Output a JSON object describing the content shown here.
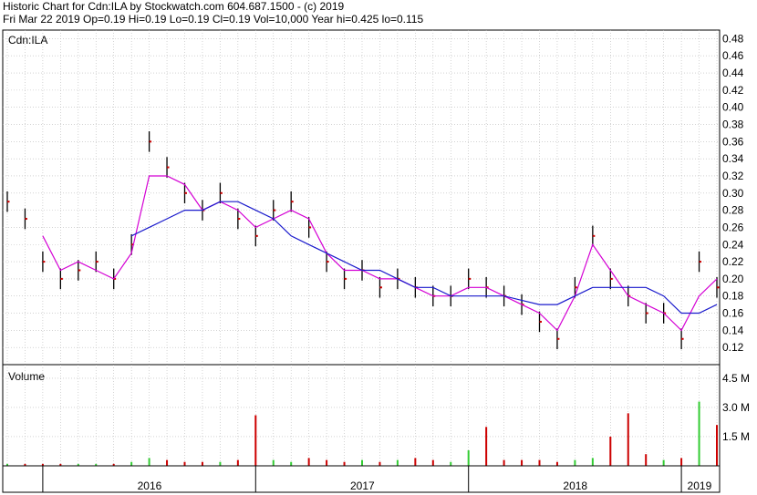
{
  "header": {
    "title": "Historic Chart for Cdn:ILA by Stockwatch.com 604.687.1500 - (c) 2019",
    "summary": "Fri Mar 22 2019  Op=0.19  Hi=0.19  Lo=0.19  Cl=0.19  Vol=10,000  Year hi=0.425  lo=0.115"
  },
  "colors": {
    "price": "#000000",
    "up_close_mark": "#cc0000",
    "ma_short": "#d400d4",
    "ma_long": "#1a1acc",
    "volume_up": "#33cc33",
    "volume_down": "#cc0000",
    "grid": "#b8b8b8",
    "frame": "#000000"
  },
  "chart_data": [
    {
      "type": "line",
      "panel": "price",
      "symbol_label": "Cdn:ILA",
      "grid": true,
      "ylim": [
        0.1,
        0.49
      ],
      "y_ticks": [
        "0.48",
        "0.46",
        "0.44",
        "0.42",
        "0.40",
        "0.38",
        "0.36",
        "0.34",
        "0.32",
        "0.30",
        "0.28",
        "0.26",
        "0.24",
        "0.22",
        "0.20",
        "0.18",
        "0.16",
        "0.14",
        "0.12"
      ],
      "x_labels": [
        "2016",
        "2017",
        "2018",
        "2019"
      ],
      "x_points": [
        "2015-11",
        "2015-12",
        "2016-01",
        "2016-02",
        "2016-03",
        "2016-04",
        "2016-05",
        "2016-06",
        "2016-07",
        "2016-08",
        "2016-09",
        "2016-10",
        "2016-11",
        "2016-12",
        "2017-01",
        "2017-02",
        "2017-03",
        "2017-04",
        "2017-05",
        "2017-06",
        "2017-07",
        "2017-08",
        "2017-09",
        "2017-10",
        "2017-11",
        "2017-12",
        "2018-01",
        "2018-02",
        "2018-03",
        "2018-04",
        "2018-05",
        "2018-06",
        "2018-07",
        "2018-08",
        "2018-09",
        "2018-10",
        "2018-11",
        "2018-12",
        "2019-01",
        "2019-02",
        "2019-03"
      ],
      "series": [
        {
          "values": [
            0.29,
            0.27,
            0.22,
            0.2,
            0.21,
            0.22,
            0.2,
            0.24,
            0.36,
            0.33,
            0.3,
            0.28,
            0.3,
            0.27,
            0.25,
            0.28,
            0.29,
            0.26,
            0.22,
            0.2,
            0.21,
            0.19,
            0.2,
            0.19,
            0.18,
            0.18,
            0.2,
            0.19,
            0.18,
            0.17,
            0.15,
            0.13,
            0.19,
            0.25,
            0.2,
            0.18,
            0.16,
            0.16,
            0.13,
            0.22,
            0.19
          ]
        },
        {
          "values": [
            null,
            null,
            0.25,
            0.21,
            0.22,
            0.21,
            0.2,
            0.23,
            0.32,
            0.32,
            0.31,
            0.28,
            0.29,
            0.28,
            0.26,
            0.27,
            0.28,
            0.27,
            0.23,
            0.21,
            0.21,
            0.2,
            0.2,
            0.19,
            0.18,
            0.18,
            0.19,
            0.19,
            0.18,
            0.17,
            0.16,
            0.14,
            0.18,
            0.24,
            0.21,
            0.18,
            0.17,
            0.16,
            0.14,
            0.18,
            0.2
          ]
        },
        {
          "values": [
            null,
            null,
            null,
            null,
            null,
            null,
            null,
            0.25,
            0.26,
            0.27,
            0.28,
            0.28,
            0.29,
            0.29,
            0.28,
            0.27,
            0.25,
            0.24,
            0.23,
            0.22,
            0.21,
            0.21,
            0.2,
            0.19,
            0.19,
            0.18,
            0.18,
            0.18,
            0.18,
            0.175,
            0.17,
            0.17,
            0.18,
            0.19,
            0.19,
            0.19,
            0.19,
            0.18,
            0.16,
            0.16,
            0.17
          ]
        }
      ]
    },
    {
      "type": "bar",
      "panel": "volume",
      "panel_label": "Volume",
      "grid": true,
      "ylim": [
        0,
        5.2
      ],
      "y_ticks": [
        "4.5 M",
        "3.0 M",
        "1.5 M"
      ],
      "x_points": [
        "2015-11",
        "2015-12",
        "2016-01",
        "2016-02",
        "2016-03",
        "2016-04",
        "2016-05",
        "2016-06",
        "2016-07",
        "2016-08",
        "2016-09",
        "2016-10",
        "2016-11",
        "2016-12",
        "2017-01",
        "2017-02",
        "2017-03",
        "2017-04",
        "2017-05",
        "2017-06",
        "2017-07",
        "2017-08",
        "2017-09",
        "2017-10",
        "2017-11",
        "2017-12",
        "2018-01",
        "2018-02",
        "2018-03",
        "2018-04",
        "2018-05",
        "2018-06",
        "2018-07",
        "2018-08",
        "2018-09",
        "2018-10",
        "2018-11",
        "2018-12",
        "2019-01",
        "2019-02",
        "2019-03"
      ],
      "values": [
        0.1,
        0.1,
        0.1,
        0.1,
        0.1,
        0.1,
        0.1,
        0.2,
        0.4,
        0.3,
        0.2,
        0.2,
        0.2,
        0.3,
        2.6,
        0.3,
        0.2,
        0.4,
        0.3,
        0.2,
        0.3,
        0.2,
        0.3,
        0.4,
        0.3,
        0.2,
        0.8,
        2.0,
        0.3,
        0.3,
        0.3,
        0.2,
        0.3,
        0.4,
        1.5,
        2.7,
        0.6,
        0.3,
        0.4,
        3.3,
        2.1
      ]
    }
  ]
}
